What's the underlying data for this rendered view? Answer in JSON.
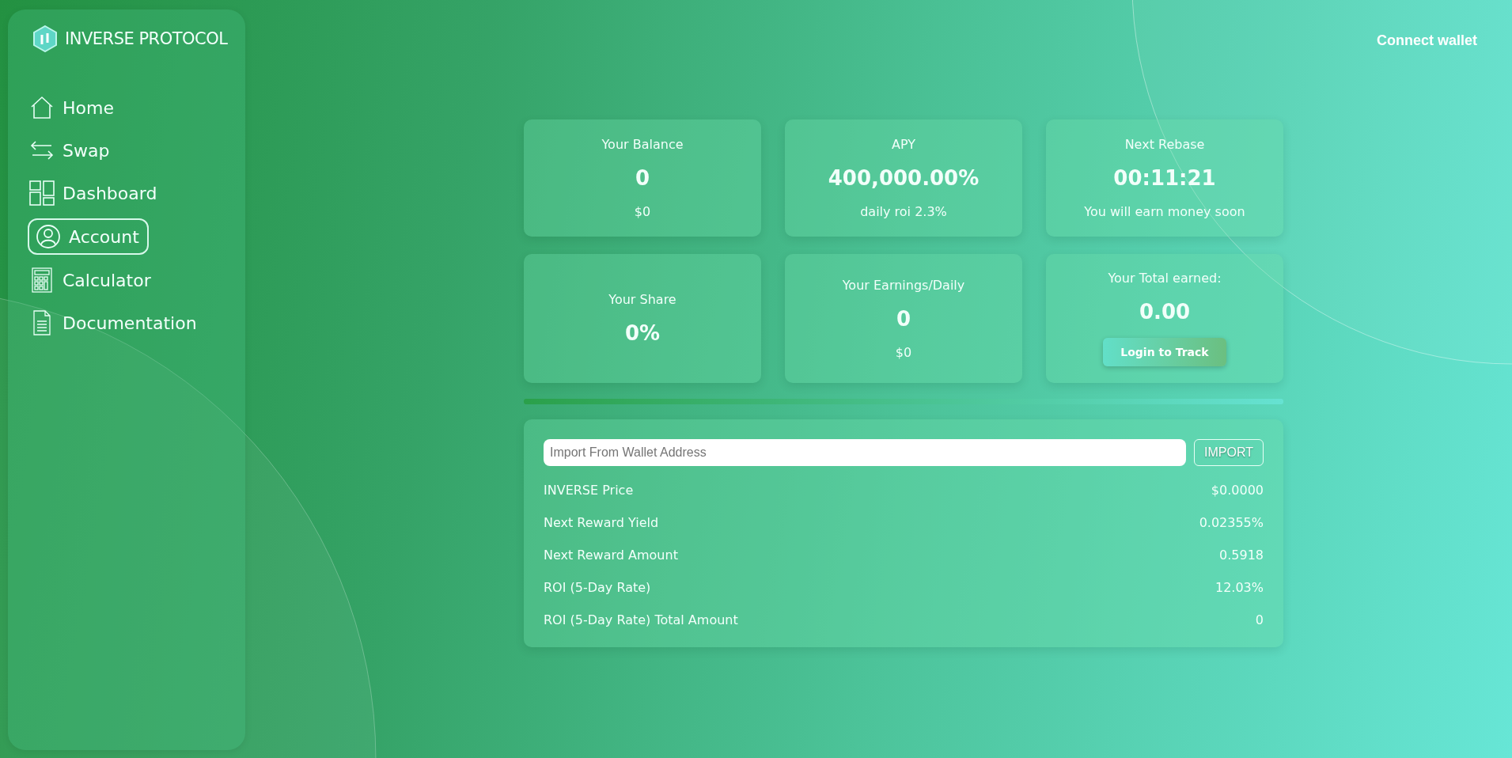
{
  "brand": {
    "name": "INVERSE PROTOCOL"
  },
  "nav": [
    {
      "label": "Home",
      "kind": "home",
      "selected": false
    },
    {
      "label": "Swap",
      "kind": "swap",
      "selected": false
    },
    {
      "label": "Dashboard",
      "kind": "dashboard",
      "selected": false
    },
    {
      "label": "Account",
      "kind": "account",
      "selected": true
    },
    {
      "label": "Calculator",
      "kind": "calculator",
      "selected": false
    },
    {
      "label": "Documentation",
      "kind": "document",
      "selected": false
    }
  ],
  "header": {
    "connect_button": "Connect wallet"
  },
  "cards": [
    {
      "label": "Your Balance",
      "value": "0",
      "sub": "$0"
    },
    {
      "label": "APY",
      "value": "400,000.00%",
      "sub": "daily roi 2.3%"
    },
    {
      "label": "Next Rebase",
      "value": "00:11:21",
      "sub": "You will earn money soon"
    },
    {
      "label": "Your Share",
      "value": "0%"
    },
    {
      "label": "Your Earnings/Daily",
      "value": "0",
      "sub": "$0"
    },
    {
      "label": "Your Total earned:",
      "value": "0.00",
      "button": "Login to Track"
    }
  ],
  "import": {
    "placeholder": "Import From Wallet Address",
    "button": "IMPORT"
  },
  "stats": [
    {
      "label": "INVERSE Price",
      "value": "$0.0000"
    },
    {
      "label": "Next Reward Yield",
      "value": "0.02355%"
    },
    {
      "label": "Next Reward Amount",
      "value": "0.5918"
    },
    {
      "label": "ROI (5-Day Rate)",
      "value": "12.03%"
    },
    {
      "label": "ROI (5-Day Rate) Total Amount",
      "value": "0"
    }
  ]
}
